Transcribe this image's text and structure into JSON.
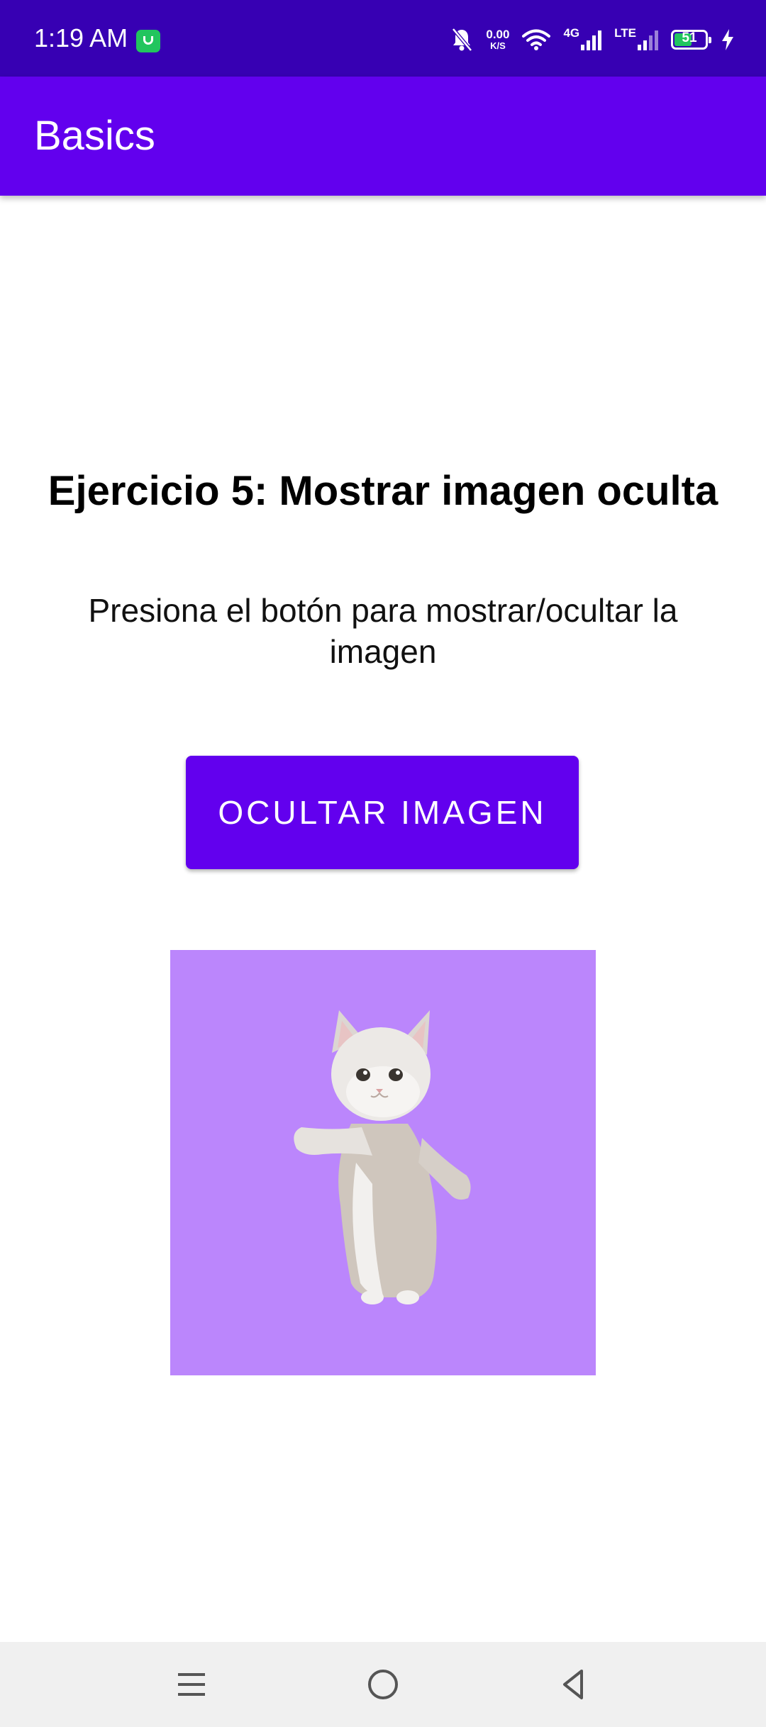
{
  "status_bar": {
    "time": "1:19 AM",
    "net_speed": "0.00",
    "net_speed_unit": "K/S",
    "network_4g": "4G",
    "network_lte": "LTE",
    "battery_level": "51",
    "icons": [
      "messaging-app-icon",
      "bell-off-icon",
      "wifi-icon",
      "signal-4g-icon",
      "signal-lte-icon",
      "battery-icon",
      "charging-bolt-icon"
    ]
  },
  "app_bar": {
    "title": "Basics"
  },
  "main": {
    "heading": "Ejercicio 5: Mostrar imagen oculta",
    "description": "Presiona el botón para mostrar/ocultar la imagen",
    "toggle_button_label": "OCULTAR IMAGEN",
    "image": {
      "subject": "white-cat",
      "background_color": "#bb86fc"
    }
  },
  "nav_bar": {
    "icons": [
      "menu-icon",
      "home-circle-icon",
      "back-triangle-icon"
    ]
  },
  "colors": {
    "status_bar": "#3700b3",
    "primary": "#6200ee",
    "image_background": "#bb86fc"
  }
}
